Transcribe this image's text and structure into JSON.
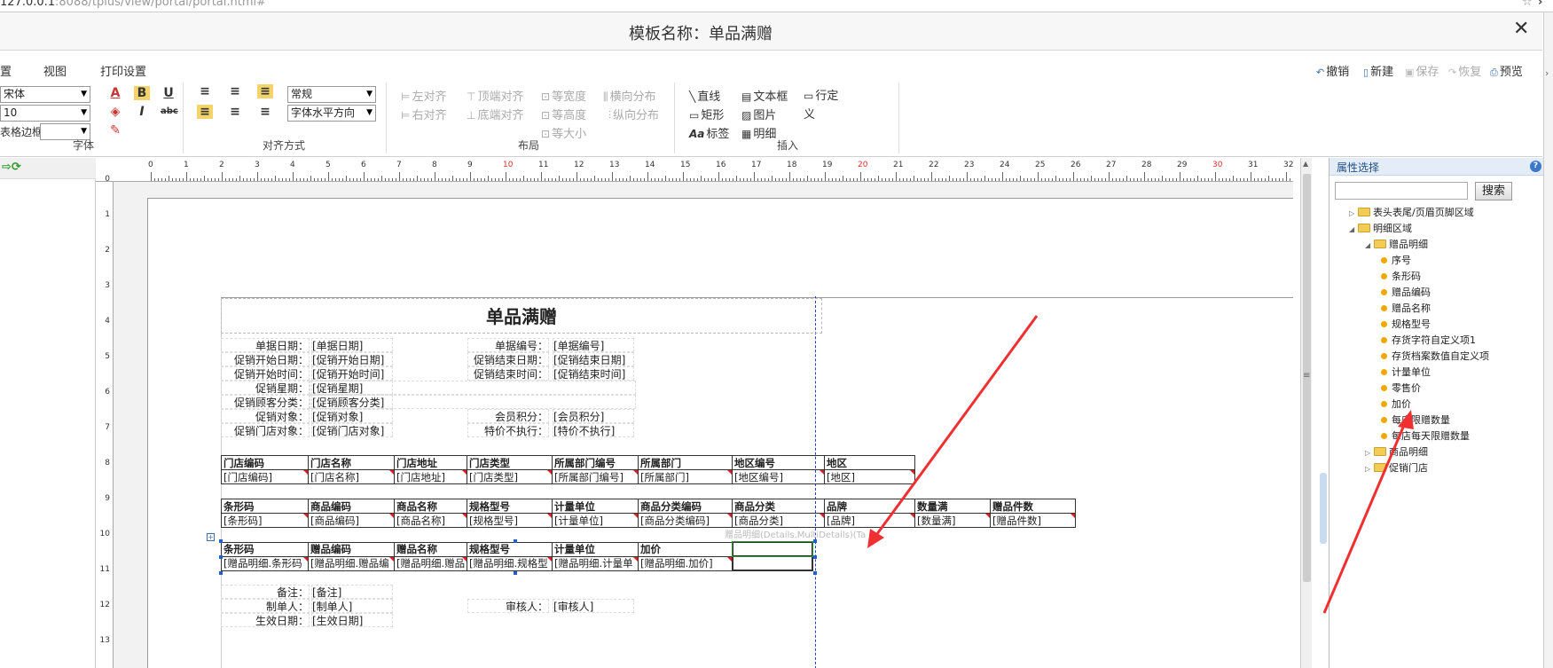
{
  "browser": {
    "url_main": "127.0.0.1",
    "url_rest": ":8088/tplus/view/portal/portal.html#"
  },
  "dialog": {
    "title": "模板名称：单品满赠",
    "close": "✕"
  },
  "menu": [
    "置",
    "视图",
    "打印设置"
  ],
  "actions": {
    "undo": "撤销",
    "new": "新建",
    "save": "保存",
    "restore": "恢复",
    "preview": "预览"
  },
  "font": {
    "family": "宋体",
    "size": "10",
    "border": "表格边框",
    "group": "字体"
  },
  "align": {
    "style": "常规",
    "direction": "字体水平方向",
    "group": "对齐方式"
  },
  "layout": {
    "left": "左对齐",
    "right": "右对齐",
    "top": "顶端对齐",
    "bottom": "底端对齐",
    "same_width": "等宽度",
    "same_height": "等高度",
    "same_size": "等大小",
    "h_dist": "横向分布",
    "v_dist": "纵向分布",
    "group": "布局"
  },
  "insert": {
    "line": "直线",
    "textbox": "文本框",
    "rowdef": "行定义",
    "rect": "矩形",
    "image": "图片",
    "label": "标签",
    "detail": "明细",
    "group": "插入"
  },
  "ruler": {
    "h": [
      "0",
      "1",
      "2",
      "3",
      "4",
      "5",
      "6",
      "7",
      "8",
      "9",
      "10",
      "11",
      "12",
      "13",
      "14",
      "15",
      "16",
      "17",
      "18",
      "19",
      "20",
      "21",
      "22",
      "23",
      "24",
      "25",
      "26",
      "27",
      "28",
      "29",
      "30",
      "31",
      "32"
    ],
    "v": [
      "0",
      "1",
      "2",
      "3",
      "4",
      "5",
      "6",
      "7",
      "8",
      "9",
      "10",
      "11",
      "12",
      "13"
    ]
  },
  "report": {
    "title": "单品满赠",
    "fields": [
      {
        "label": "单据日期：",
        "value": "[单据日期]"
      },
      {
        "label": "单据编号：",
        "value": "[单据编号]"
      },
      {
        "label": "促销开始日期：",
        "value": "[促销开始日期]"
      },
      {
        "label": "促销结束日期：",
        "value": "[促销结束日期]"
      },
      {
        "label": "促销开始时间：",
        "value": "[促销开始时间]"
      },
      {
        "label": "促销结束时间：",
        "value": "[促销结束时间]"
      },
      {
        "label": "促销星期：",
        "value": "[促销星期]"
      },
      {
        "label": "促销顾客分类：",
        "value": "[促销顾客分类]"
      },
      {
        "label": "促销对象：",
        "value": "[促销对象]"
      },
      {
        "label": "会员积分：",
        "value": "[会员积分]"
      },
      {
        "label": "促销门店对象：",
        "value": "[促销门店对象]"
      },
      {
        "label": "特价不执行：",
        "value": "[特价不执行]"
      }
    ],
    "store_table": {
      "headers": [
        "门店编码",
        "门店名称",
        "门店地址",
        "门店类型",
        "所属部门编号",
        "所属部门",
        "地区编号",
        "地区"
      ],
      "row": [
        "[门店编码]",
        "[门店名称]",
        "[门店地址]",
        "[门店类型]",
        "[所属部门编号]",
        "[所属部门]",
        "[地区编号]",
        "[地区]"
      ]
    },
    "product_table": {
      "headers": [
        "条形码",
        "商品编码",
        "商品名称",
        "规格型号",
        "计量单位",
        "商品分类编码",
        "商品分类",
        "品牌",
        "数量满",
        "赠品件数"
      ],
      "row": [
        "[条形码]",
        "[商品编码]",
        "[商品名称]",
        "[规格型号]",
        "[计量单位]",
        "[商品分类编码]",
        "[商品分类]",
        "[品牌]",
        "[数量满]",
        "[赠品件数]"
      ]
    },
    "gift_caption": "赠品明细(Details.MultiDetails)(Ta",
    "gift_table": {
      "headers": [
        "条形码",
        "赠品编码",
        "赠品名称",
        "规格型号",
        "计量单位",
        "加价",
        ""
      ],
      "row": [
        "[赠品明细.条形码",
        "[赠品明细.赠品编",
        "[赠品明细.赠品",
        "[赠品明细.规格型",
        "[赠品明细.计量单",
        "[赠品明细.加价]",
        ""
      ]
    },
    "footer": [
      {
        "label": "备注：",
        "value": "[备注]"
      },
      {
        "label": "制单人：",
        "value": "[制单人]"
      },
      {
        "label": "审核人：",
        "value": "[审核人]"
      },
      {
        "label": "生效日期：",
        "value": "[生效日期]"
      }
    ]
  },
  "props": {
    "header": "属性选择",
    "help": "?",
    "search_btn": "搜索",
    "tree": [
      {
        "text": "表头表尾/页眉页脚区域",
        "type": "folder",
        "indent": 0,
        "tw": "▷"
      },
      {
        "text": "明细区域",
        "type": "folder",
        "indent": 0,
        "tw": "◢"
      },
      {
        "text": "赠品明细",
        "type": "folder",
        "indent": 1,
        "tw": "◢"
      },
      {
        "text": "序号",
        "type": "leaf",
        "indent": 2
      },
      {
        "text": "条形码",
        "type": "leaf",
        "indent": 2
      },
      {
        "text": "赠品编码",
        "type": "leaf",
        "indent": 2
      },
      {
        "text": "赠品名称",
        "type": "leaf",
        "indent": 2
      },
      {
        "text": "规格型号",
        "type": "leaf",
        "indent": 2
      },
      {
        "text": "存货字符自定义项1",
        "type": "leaf",
        "indent": 2
      },
      {
        "text": "存货档案数值自定义项",
        "type": "leaf",
        "indent": 2
      },
      {
        "text": "计量单位",
        "type": "leaf",
        "indent": 2
      },
      {
        "text": "零售价",
        "type": "leaf",
        "indent": 2
      },
      {
        "text": "加价",
        "type": "leaf",
        "indent": 2
      },
      {
        "text": "每店限赠数量",
        "type": "leaf",
        "indent": 2
      },
      {
        "text": "每店每天限赠数量",
        "type": "leaf",
        "indent": 2
      },
      {
        "text": "商品明细",
        "type": "folder",
        "indent": 1,
        "tw": "▷"
      },
      {
        "text": "促销门店",
        "type": "folder",
        "indent": 1,
        "tw": "▷"
      }
    ]
  },
  "colors": {
    "accent": "#3a6fb0",
    "arrow": "#f03030",
    "selection": "#1f5fd0"
  }
}
